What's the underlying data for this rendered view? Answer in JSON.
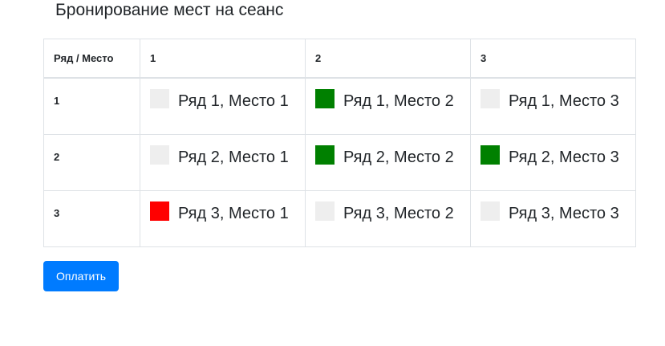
{
  "page": {
    "title": "Бронирование мест на сеанс"
  },
  "table": {
    "corner_header": "Ряд / Место",
    "columns": [
      "1",
      "2",
      "3"
    ],
    "rows": [
      {
        "label": "1",
        "seats": [
          {
            "label": "Ряд 1, Место 1",
            "status": "free"
          },
          {
            "label": "Ряд 1, Место 2",
            "status": "occupied"
          },
          {
            "label": "Ряд 1, Место 3",
            "status": "free"
          }
        ]
      },
      {
        "label": "2",
        "seats": [
          {
            "label": "Ряд 2, Место 1",
            "status": "free"
          },
          {
            "label": "Ряд 2, Место 2",
            "status": "occupied"
          },
          {
            "label": "Ряд 2, Место 3",
            "status": "occupied"
          }
        ]
      },
      {
        "label": "3",
        "seats": [
          {
            "label": "Ряд 3, Место 1",
            "status": "selected"
          },
          {
            "label": "Ряд 3, Место 2",
            "status": "free"
          },
          {
            "label": "Ряд 3, Место 3",
            "status": "free"
          }
        ]
      }
    ]
  },
  "status_colors": {
    "free": "#eeeeee",
    "occupied": "#008000",
    "selected": "#ff0000"
  },
  "actions": {
    "pay_label": "Оплатить"
  }
}
